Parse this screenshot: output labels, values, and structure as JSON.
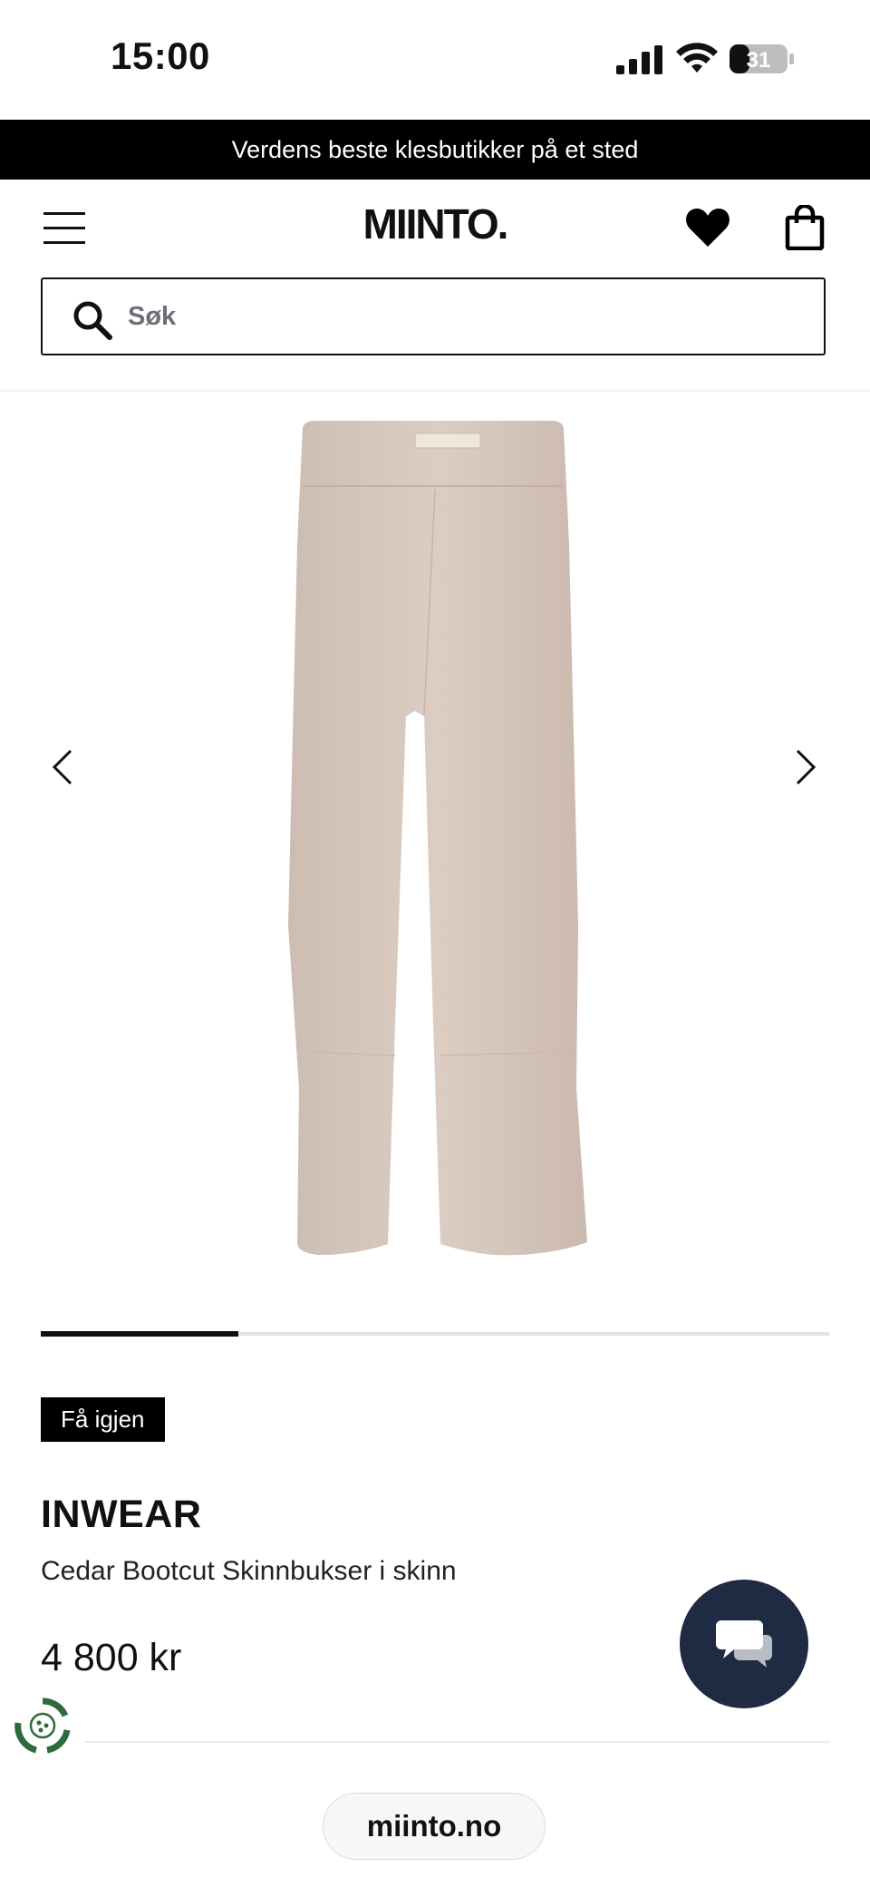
{
  "status_bar": {
    "time": "15:00",
    "battery_level": "31"
  },
  "promo_banner": {
    "text": "Verdens beste klesbutikker på et sted"
  },
  "header": {
    "logo": "MIINTO.",
    "icons": [
      "menu-icon",
      "heart-icon",
      "shopping-bag-icon"
    ]
  },
  "search": {
    "placeholder": "Søk",
    "value": ""
  },
  "carousel": {
    "progress": 0.25,
    "image_alt": "Cedar Bootcut Skinnbukser i skinn"
  },
  "product": {
    "badge": "Få igjen",
    "brand": "INWEAR",
    "name": "Cedar Bootcut Skinnbukser i skinn",
    "price": "4 800 kr"
  },
  "colors": {
    "accent": "#000000",
    "chat_button": "#1e2b42",
    "product_tone": "#d8c8be"
  },
  "browser": {
    "url": "miinto.no"
  }
}
